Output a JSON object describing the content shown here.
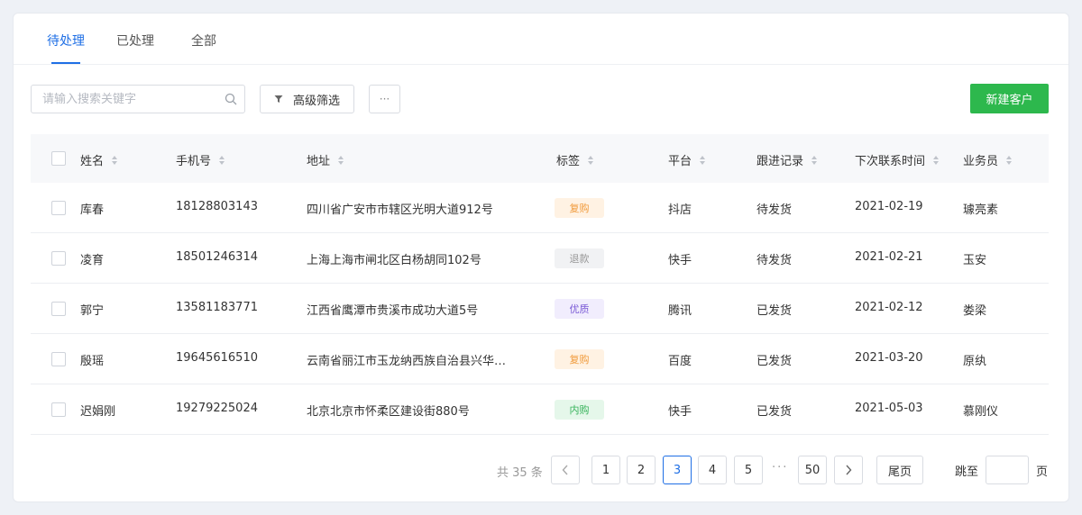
{
  "tabs": [
    {
      "label": "待处理",
      "active": true
    },
    {
      "label": "已处理",
      "active": false
    },
    {
      "label": "全部",
      "active": false
    }
  ],
  "toolbar": {
    "search_placeholder": "请输入搜索关键字",
    "filter_label": "高级筛选",
    "more_label": "···",
    "new_label": "新建客户"
  },
  "table": {
    "columns": [
      "姓名",
      "手机号",
      "地址",
      "标签",
      "平台",
      "跟进记录",
      "下次联系时间",
      "业务员"
    ],
    "rows": [
      {
        "name": "库春",
        "phone": "18128803143",
        "address": "四川省广安市市辖区光明大道912号",
        "tag": "复购",
        "tag_color": "#f09a3b",
        "platform": "抖店",
        "record": "待发货",
        "next": "2021-02-19",
        "staff": "璩亮素"
      },
      {
        "name": "凌育",
        "phone": "18501246314",
        "address": "上海上海市闸北区白杨胡同102号",
        "tag": "退款",
        "tag_color": "#999999",
        "platform": "快手",
        "record": "待发货",
        "next": "2021-02-21",
        "staff": "玉安"
      },
      {
        "name": "郭宁",
        "phone": "13581183771",
        "address": "江西省鹰潭市贵溪市成功大道5号",
        "tag": "优质",
        "tag_color": "#7b5bd6",
        "platform": "腾讯",
        "record": "已发货",
        "next": "2021-02-12",
        "staff": "娄梁"
      },
      {
        "name": "殷瑶",
        "phone": "19645616510",
        "address": "云南省丽江市玉龙纳西族自治县兴华…",
        "tag": "复购",
        "tag_color": "#f09a3b",
        "platform": "百度",
        "record": "已发货",
        "next": "2021-03-20",
        "staff": "原纨"
      },
      {
        "name": "迟娟刚",
        "phone": "19279225024",
        "address": "北京北京市怀柔区建设街880号",
        "tag": "内购",
        "tag_color": "#36b35a",
        "platform": "快手",
        "record": "已发货",
        "next": "2021-05-03",
        "staff": "慕刚仪"
      }
    ]
  },
  "pagination": {
    "total_label": "共 35 条",
    "pages": [
      "1",
      "2",
      "3",
      "4",
      "5"
    ],
    "current": "3",
    "ellipsis": "···",
    "last_page": "50",
    "last_label": "尾页",
    "jump_label": "跳至",
    "jump_suffix": "页"
  },
  "colors": {
    "accent": "#1f6fe5",
    "primary_button": "#2db84d"
  }
}
